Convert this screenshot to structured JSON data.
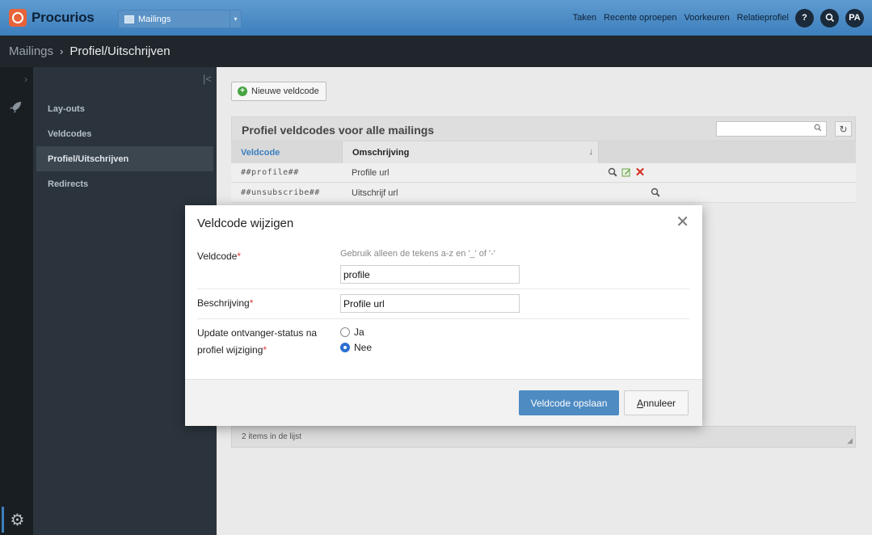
{
  "app": {
    "brand": "Procurios",
    "module_select": "Mailings"
  },
  "topnav": {
    "items": [
      "Taken",
      "Recente oproepen",
      "Voorkeuren",
      "Relatieprofiel"
    ],
    "help": "?",
    "avatar": "PA"
  },
  "breadcrumb": {
    "root": "Mailings",
    "separator": "›",
    "current": "Profiel/Uitschrijven"
  },
  "sidebar": {
    "items": [
      "Lay-outs",
      "Veldcodes",
      "Profiel/Uitschrijven",
      "Redirects"
    ],
    "active_index": 2
  },
  "toolbar": {
    "new_button": "Nieuwe veldcode"
  },
  "panel": {
    "title": "Profiel veldcodes voor alle mailings",
    "columns": [
      "Veldcode",
      "Omschrijving"
    ],
    "rows": [
      {
        "code": "##profile##",
        "description": "Profile url"
      },
      {
        "code": "##unsubscribe##",
        "description": "Uitschrijf url"
      }
    ],
    "footer": "2 items in de lijst"
  },
  "modal": {
    "title": "Veldcode wijzigen",
    "fields": {
      "code_label": "Veldcode",
      "code_hint": "Gebruik alleen de tekens a-z en '_' of '-'",
      "code_value": "profile",
      "desc_label": "Beschrijving",
      "desc_value": "Profile url",
      "status_label_line1": "Update ontvanger-status na",
      "status_label_line2": "profiel wijziging",
      "options": [
        "Ja",
        "Nee"
      ],
      "selected_option": "Nee"
    },
    "required_mark": "*",
    "save_button": "Veldcode opslaan",
    "cancel_first_letter": "A",
    "cancel_rest": "nnuleer"
  },
  "colors": {
    "topbar": "#3d7fbd",
    "sidebar": "#2b343c",
    "primary_button": "#4e8bc3",
    "delete_icon": "#d52b1e"
  }
}
